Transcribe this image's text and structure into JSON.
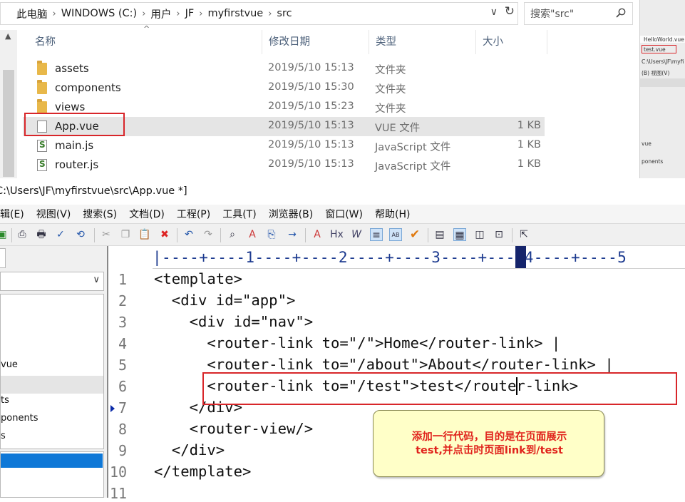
{
  "explorer": {
    "breadcrumb": [
      "此电脑",
      "WINDOWS (C:)",
      "用户",
      "JF",
      "myfirstvue",
      "src"
    ],
    "search_placeholder": "搜索\"src\"",
    "columns": [
      "名称",
      "修改日期",
      "类型",
      "大小"
    ],
    "rows": [
      {
        "name": "assets",
        "date": "2019/5/10 15:13",
        "type": "文件夹",
        "size": "",
        "icon": "folder-icon"
      },
      {
        "name": "components",
        "date": "2019/5/10 15:30",
        "type": "文件夹",
        "size": "",
        "icon": "folder-icon"
      },
      {
        "name": "views",
        "date": "2019/5/10 15:23",
        "type": "文件夹",
        "size": "",
        "icon": "folder-icon"
      },
      {
        "name": "App.vue",
        "date": "2019/5/10 15:13",
        "type": "VUE 文件",
        "size": "1 KB",
        "icon": "document-icon"
      },
      {
        "name": "main.js",
        "date": "2019/5/10 15:13",
        "type": "JavaScript 文件",
        "size": "1 KB",
        "icon": "script-icon"
      },
      {
        "name": "router.js",
        "date": "2019/5/10 15:13",
        "type": "JavaScript 文件",
        "size": "1 KB",
        "icon": "script-icon"
      }
    ]
  },
  "background_window": {
    "labels": [
      "HelloWorld.vue",
      "test.vue",
      "C:\\Users\\JF\\myfi",
      "(B)  视图(V)",
      "vue",
      "ponents"
    ]
  },
  "editor": {
    "title": "C:\\Users\\JF\\myfirstvue\\src\\App.vue *]",
    "menu": [
      "编辑(E)",
      "视图(V)",
      "搜索(S)",
      "文档(D)",
      "工程(P)",
      "工具(T)",
      "浏览器(B)",
      "窗口(W)",
      "帮助(H)"
    ],
    "ruler": "|----+----1----+----2----+----3----+----4----+----5",
    "tree_items": [
      "vue",
      "ts",
      "ponents",
      "s"
    ],
    "line_numbers": [
      "1",
      "2",
      "3",
      "4",
      "5",
      "6",
      "7",
      "8",
      "9",
      "10",
      "11"
    ],
    "code_lines": [
      "<template>",
      "  <div id=\"app\">",
      "    <div id=\"nav\">",
      "      <router-link to=\"/\">Home</router-link> |",
      "      <router-link to=\"/about\">About</router-link> |",
      "      <router-link to=\"/test\">test</router-link>",
      "    </div>",
      "    <router-view/>",
      "  </div>",
      "</template>",
      ""
    ]
  },
  "annotation": {
    "text_line1": "添加一行代码，目的是在页面展示",
    "text_line2": "test,并点击时页面link到/test"
  },
  "colors": {
    "highlight_red": "#d8262a",
    "note_bg": "#ffffc8",
    "note_text": "#e0231c",
    "ruler_blue": "#1c3a8f",
    "selection_blue": "#0f78d7"
  }
}
